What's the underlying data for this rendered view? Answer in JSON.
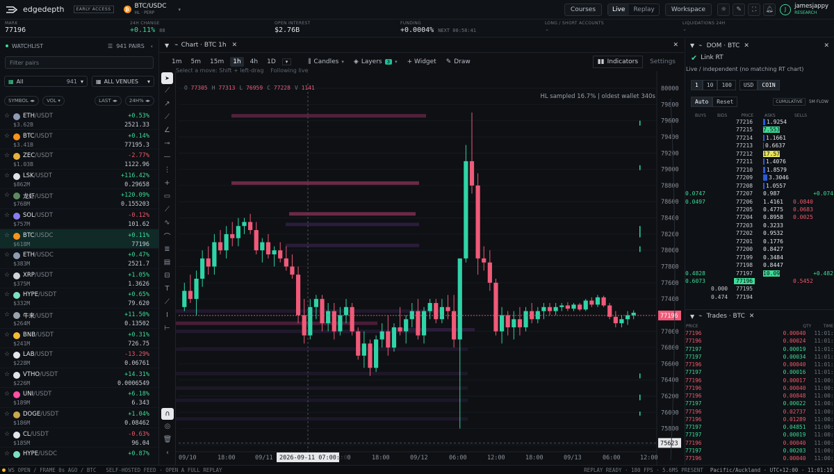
{
  "app": {
    "name": "edgedepth",
    "badge": "EARLY ACCESS",
    "symbol": "BTC/USDC",
    "symbol_sub": "HL · PERP"
  },
  "nav": {
    "courses": "Courses",
    "live": "Live",
    "replay": "Replay",
    "workspace": "Workspace",
    "user": "jamesjappy",
    "user_role": "RESEARCH",
    "avatar_initial": "J"
  },
  "stats": [
    {
      "label": "MARK",
      "value": "77196",
      "extra": ""
    },
    {
      "label": "24H CHANGE",
      "value": "+0.11%",
      "extra": "88"
    },
    {
      "label": "OPEN INTEREST",
      "value": "$2.76B",
      "extra": ""
    },
    {
      "label": "FUNDING",
      "value": "+0.0004%",
      "extra": "NEXT 00:58:41"
    },
    {
      "label": "LONG / SHORT ACCOUNTS",
      "value": "-",
      "extra": ""
    },
    {
      "label": "LIQUIDATIONS 24H",
      "value": "-",
      "extra": ""
    }
  ],
  "watchlist": {
    "title": "WATCHLIST",
    "pairs": "941 PAIRS",
    "filter_placeholder": "Filter pairs",
    "all_label": "All",
    "all_count": "941",
    "venues": "ALL VENUES",
    "sort": [
      "SYMBOL",
      "VOL",
      "LAST",
      "24H%"
    ],
    "rows": [
      {
        "base": "ETH",
        "quote": "/USDT",
        "vol": "$3.62B",
        "chg": "+0.53%",
        "price": "2521.33",
        "dir": "up",
        "icon": "#8e9bb5"
      },
      {
        "base": "BTC",
        "quote": "/USDT",
        "vol": "$3.41B",
        "chg": "+0.14%",
        "price": "77195.3",
        "dir": "up",
        "icon": "#f7931a"
      },
      {
        "base": "ZEC",
        "quote": "/USDT",
        "vol": "$1.03B",
        "chg": "-2.77%",
        "price": "1122.96",
        "dir": "down",
        "icon": "#e7b23c"
      },
      {
        "base": "LSK",
        "quote": "/USDT",
        "vol": "$862M",
        "chg": "+116.42%",
        "price": "0.29658",
        "dir": "up",
        "icon": "#dfe3ea"
      },
      {
        "base": "龙虾",
        "quote": "/USDT",
        "vol": "$768M",
        "chg": "+120.09%",
        "price": "0.155203",
        "dir": "up",
        "icon": "#5b8a5f"
      },
      {
        "base": "SOL",
        "quote": "/USDT",
        "vol": "$757M",
        "chg": "-0.12%",
        "price": "101.62",
        "dir": "down",
        "icon": "#8a7cf0"
      },
      {
        "base": "BTC",
        "quote": "/USDC",
        "vol": "$618M",
        "chg": "+0.11%",
        "price": "77196",
        "dir": "up",
        "icon": "#f7931a",
        "active": true
      },
      {
        "base": "ETH",
        "quote": "/USDC",
        "vol": "$383M",
        "chg": "+0.47%",
        "price": "2521.7",
        "dir": "up",
        "icon": "#8e9bb5"
      },
      {
        "base": "XRP",
        "quote": "/USDT",
        "vol": "$375M",
        "chg": "+1.05%",
        "price": "1.3626",
        "dir": "up",
        "icon": "#cfd4db"
      },
      {
        "base": "HYPE",
        "quote": "/USDT",
        "vol": "$332M",
        "chg": "+0.65%",
        "price": "79.620",
        "dir": "up",
        "icon": "#7be0c0"
      },
      {
        "base": "牛来",
        "quote": "/USDT",
        "vol": "$264M",
        "chg": "+11.50%",
        "price": "0.13502",
        "dir": "up",
        "icon": "#9aa2ad"
      },
      {
        "base": "BNB",
        "quote": "/USDT",
        "vol": "$241M",
        "chg": "+0.31%",
        "price": "726.75",
        "dir": "up",
        "icon": "#f3ba2f"
      },
      {
        "base": "LAB",
        "quote": "/USDT",
        "vol": "$228M",
        "chg": "-13.29%",
        "price": "0.06761",
        "dir": "down",
        "icon": "#e3e6ea"
      },
      {
        "base": "VTHO",
        "quote": "/USDT",
        "vol": "$226M",
        "chg": "+14.31%",
        "price": "0.0006549",
        "dir": "up",
        "icon": "#dfe3ea"
      },
      {
        "base": "UNI",
        "quote": "/USDT",
        "vol": "$189M",
        "chg": "+6.18%",
        "price": "6.343",
        "dir": "up",
        "icon": "#ff4fa3"
      },
      {
        "base": "DOGE",
        "quote": "/USDT",
        "vol": "$186M",
        "chg": "+1.04%",
        "price": "0.08462",
        "dir": "up",
        "icon": "#c9a74a"
      },
      {
        "base": "CL",
        "quote": "/USDT",
        "vol": "$185M",
        "chg": "-0.63%",
        "price": "96.04",
        "dir": "down",
        "icon": "#e3e6ea"
      },
      {
        "base": "HYPE",
        "quote": "/USDC",
        "vol": "",
        "chg": "+0.87%",
        "price": "",
        "dir": "up",
        "icon": "#7be0c0"
      }
    ]
  },
  "chart": {
    "tab": "Chart · BTC 1h",
    "timeframes": [
      "1m",
      "5m",
      "15m",
      "1h",
      "4h",
      "1D"
    ],
    "active_tf": "1h",
    "candles_label": "Candles",
    "layers_label": "Layers",
    "layers_count": "3",
    "widget_label": "+ Widget",
    "draw_label": "Draw",
    "indicators_label": "Indicators",
    "settings_label": "Settings",
    "hint": "Select a move: Shift + left-drag",
    "following": "Following live",
    "ohlcv": {
      "O": "77305",
      "H": "77313",
      "L": "76959",
      "C": "77228",
      "V": "1141"
    },
    "sampled": "HL sampled 16.7% | oldest wallet 340s",
    "current_price": "77196",
    "crosshair_price": "75623",
    "crosshair_time": "2026-09-11 07:00:00",
    "x_labels": [
      "09/10",
      "18:00",
      "09/11",
      "06:00",
      "12:00",
      "18:00",
      "09/12",
      "06:00",
      "12:00",
      "18:00",
      "09/13",
      "06:00",
      "12:00"
    ],
    "y_labels": [
      "80000",
      "79800",
      "79600",
      "79400",
      "79200",
      "79000",
      "78800",
      "78600",
      "78400",
      "78200",
      "78000",
      "77800",
      "77600",
      "77400",
      "77200",
      "77000",
      "76800",
      "76600",
      "76400",
      "76200",
      "76000",
      "75800",
      "75600"
    ]
  },
  "chart_data": {
    "type": "candlestick",
    "ylim": [
      75540,
      80060
    ],
    "candles": [
      [
        77300,
        77600,
        77250,
        77500
      ],
      [
        77500,
        77700,
        77350,
        77400
      ],
      [
        77400,
        77750,
        77200,
        77650
      ],
      [
        77650,
        78000,
        77550,
        77900
      ],
      [
        77900,
        78050,
        77700,
        77800
      ],
      [
        77800,
        78200,
        77700,
        78100
      ],
      [
        78100,
        78250,
        77950,
        78000
      ],
      [
        78000,
        78300,
        77900,
        78200
      ],
      [
        78200,
        78350,
        78050,
        78150
      ],
      [
        78150,
        78400,
        78050,
        78300
      ],
      [
        78300,
        78400,
        78200,
        78350
      ],
      [
        78350,
        78450,
        78200,
        78250
      ],
      [
        78250,
        78350,
        77950,
        78000
      ],
      [
        78000,
        78150,
        77850,
        78100
      ],
      [
        78100,
        78200,
        77900,
        77950
      ],
      [
        77950,
        78050,
        77800,
        78000
      ],
      [
        78000,
        78100,
        77850,
        77900
      ],
      [
        77900,
        78050,
        77750,
        77800
      ],
      [
        77800,
        77950,
        77650,
        77700
      ],
      [
        77700,
        77800,
        77100,
        77200
      ],
      [
        77200,
        77400,
        76850,
        76950
      ],
      [
        76950,
        77400,
        76900,
        77300
      ],
      [
        77300,
        77450,
        77150,
        77400
      ],
      [
        77400,
        77450,
        77000,
        77100
      ],
      [
        77100,
        77350,
        77000,
        77250
      ],
      [
        77250,
        77350,
        76900,
        77000
      ],
      [
        77000,
        77300,
        76950,
        77200
      ],
      [
        77200,
        77400,
        77100,
        77300
      ],
      [
        77300,
        77350,
        76950,
        77000
      ],
      [
        77000,
        77050,
        76650,
        76700
      ],
      [
        76700,
        77000,
        76550,
        76850
      ],
      [
        76850,
        76900,
        76450,
        76550
      ],
      [
        76550,
        76950,
        76500,
        76900
      ],
      [
        76900,
        77100,
        76800,
        77000
      ],
      [
        77000,
        77200,
        76700,
        76800
      ],
      [
        76800,
        77100,
        76750,
        77050
      ],
      [
        77050,
        77300,
        76950,
        77000
      ],
      [
        77000,
        77200,
        76850,
        77150
      ],
      [
        77150,
        77350,
        77050,
        77250
      ],
      [
        77250,
        77400,
        76900,
        76950
      ],
      [
        76950,
        77300,
        76850,
        77250
      ],
      [
        77250,
        77400,
        77150,
        77350
      ],
      [
        77350,
        77400,
        77100,
        77150
      ],
      [
        77150,
        77400,
        77100,
        77300
      ],
      [
        77300,
        77450,
        77150,
        77250
      ],
      [
        77250,
        77450,
        76800,
        76900
      ],
      [
        76900,
        77300,
        75800,
        77900
      ],
      [
        77900,
        79300,
        77850,
        79100
      ],
      [
        79100,
        79700,
        78700,
        78800
      ],
      [
        78800,
        78950,
        77700,
        77900
      ],
      [
        77900,
        78050,
        77750,
        77850
      ],
      [
        77850,
        78000,
        77500,
        77600
      ],
      [
        77600,
        77650,
        76950,
        77000
      ],
      [
        77000,
        77300,
        76850,
        77200
      ],
      [
        77200,
        77250,
        76950,
        77050
      ],
      [
        77050,
        77250,
        76900,
        77150
      ],
      [
        77150,
        77300,
        76950,
        77050
      ],
      [
        77050,
        77300,
        77000,
        77250
      ],
      [
        77250,
        77350,
        77100,
        77150
      ],
      [
        77150,
        77300,
        77100,
        77250
      ],
      [
        77250,
        77350,
        77150,
        77300
      ],
      [
        77300,
        77350,
        77200,
        77250
      ],
      [
        77250,
        77350,
        77200,
        77300
      ],
      [
        77300,
        77350,
        77250,
        77320
      ],
      [
        77320,
        77360,
        77250,
        77280
      ],
      [
        77280,
        77350,
        77250,
        77330
      ],
      [
        77330,
        77350,
        77250,
        77270
      ],
      [
        77270,
        77400,
        77250,
        77380
      ],
      [
        77380,
        77420,
        77300,
        77330
      ],
      [
        77330,
        77450,
        77300,
        77420
      ],
      [
        77420,
        77440,
        77300,
        77320
      ],
      [
        77320,
        77350,
        77150,
        77180
      ],
      [
        77180,
        77250,
        77050,
        77100
      ],
      [
        77100,
        77200,
        77050,
        77150
      ],
      [
        77150,
        77250,
        77080,
        77200
      ],
      [
        77200,
        77260,
        77150,
        77230
      ]
    ]
  },
  "dom": {
    "title": "DOM · BTC",
    "link": "Link RT",
    "note": "Live / independent (no matching RT chart)",
    "sizes": [
      "1",
      "10",
      "100"
    ],
    "units": [
      "USD",
      "COIN"
    ],
    "auto": "Auto",
    "reset": "Reset",
    "cumulative": "CUMULATIVE",
    "smflow": "5M FLOW",
    "cols": [
      "BUYS",
      "BIDS",
      "PRICE",
      "ASKS",
      "SELLS"
    ],
    "rows": [
      {
        "buys": "",
        "bids": "",
        "price": "77216",
        "asks": "1.9254",
        "sells": ""
      },
      {
        "buys": "",
        "bids": "",
        "price": "77215",
        "asks": "7.553",
        "sells": ""
      },
      {
        "buys": "",
        "bids": "",
        "price": "77214",
        "asks": "1.1661",
        "sells": ""
      },
      {
        "buys": "",
        "bids": "",
        "price": "77213",
        "asks": "0.6637",
        "sells": ""
      },
      {
        "buys": "",
        "bids": "",
        "price": "77212",
        "asks": "17.57",
        "sells": ""
      },
      {
        "buys": "",
        "bids": "",
        "price": "77211",
        "asks": "1.4076",
        "sells": ""
      },
      {
        "buys": "",
        "bids": "",
        "price": "77210",
        "asks": "1.8579",
        "sells": ""
      },
      {
        "buys": "",
        "bids": "",
        "price": "77209",
        "asks": "3.3046",
        "sells": ""
      },
      {
        "buys": "",
        "bids": "",
        "price": "77208",
        "asks": "1.0557",
        "sells": ""
      },
      {
        "buys": "0.0747",
        "bids": "",
        "price": "77207",
        "asks": "0.987",
        "sells": "+0.074"
      },
      {
        "buys": "0.0497",
        "bids": "",
        "price": "77206",
        "asks": "1.4161",
        "sells": "0.0840"
      },
      {
        "buys": "",
        "bids": "",
        "price": "77205",
        "asks": "0.4775",
        "sells": "0.0683"
      },
      {
        "buys": "",
        "bids": "",
        "price": "77204",
        "asks": "0.8958",
        "sells": "0.0025"
      },
      {
        "buys": "",
        "bids": "",
        "price": "77203",
        "asks": "0.3233",
        "sells": ""
      },
      {
        "buys": "",
        "bids": "",
        "price": "77202",
        "asks": "0.9532",
        "sells": ""
      },
      {
        "buys": "",
        "bids": "",
        "price": "77201",
        "asks": "0.1776",
        "sells": ""
      },
      {
        "buys": "",
        "bids": "",
        "price": "77200",
        "asks": "0.8427",
        "sells": ""
      },
      {
        "buys": "",
        "bids": "",
        "price": "77199",
        "asks": "0.3484",
        "sells": ""
      },
      {
        "buys": "",
        "bids": "",
        "price": "77198",
        "asks": "0.8447",
        "sells": ""
      },
      {
        "buys": "0.4828",
        "bids": "",
        "price": "77197",
        "asks": "10.09",
        "sells": "+0.482"
      },
      {
        "buys": "0.6073",
        "bids": "",
        "price": "77196",
        "asks": "",
        "sells": "0.5452"
      },
      {
        "buys": "",
        "bids": "0.000",
        "price": "77195",
        "asks": "",
        "sells": ""
      },
      {
        "buys": "",
        "bids": "0.474",
        "price": "77194",
        "asks": "",
        "sells": ""
      }
    ]
  },
  "trades": {
    "title": "Trades · BTC",
    "cols": [
      "PRICE",
      "QTY",
      "TIME"
    ],
    "rows": [
      {
        "price": "77196",
        "qty": "0.00040",
        "time": "11:01:19",
        "side": "sell"
      },
      {
        "price": "77196",
        "qty": "0.00024",
        "time": "11:01:14",
        "side": "sell"
      },
      {
        "price": "77197",
        "qty": "0.00019",
        "time": "11:01:10",
        "side": "buy"
      },
      {
        "price": "77197",
        "qty": "0.00034",
        "time": "11:01:08",
        "side": "buy"
      },
      {
        "price": "77196",
        "qty": "0.00040",
        "time": "11:01:03",
        "side": "sell"
      },
      {
        "price": "77197",
        "qty": "0.00016",
        "time": "11:01:00",
        "side": "buy"
      },
      {
        "price": "77196",
        "qty": "0.00017",
        "time": "11:00:59",
        "side": "sell"
      },
      {
        "price": "77196",
        "qty": "0.00040",
        "time": "11:00:56",
        "side": "sell"
      },
      {
        "price": "77196",
        "qty": "0.00848",
        "time": "11:00:52",
        "side": "sell"
      },
      {
        "price": "77197",
        "qty": "0.00022",
        "time": "11:00:49",
        "side": "buy"
      },
      {
        "price": "77196",
        "qty": "0.02737",
        "time": "11:00:48",
        "side": "sell"
      },
      {
        "price": "77196",
        "qty": "0.01289",
        "time": "11:00:47",
        "side": "sell"
      },
      {
        "price": "77197",
        "qty": "0.04851",
        "time": "11:00:46",
        "side": "buy"
      },
      {
        "price": "77197",
        "qty": "0.00019",
        "time": "11:00:44",
        "side": "buy"
      },
      {
        "price": "77196",
        "qty": "0.00040",
        "time": "11:00:43",
        "side": "sell"
      },
      {
        "price": "77197",
        "qty": "0.00203",
        "time": "11:00:42",
        "side": "buy"
      },
      {
        "price": "77196",
        "qty": "0.00040",
        "time": "11:00:40",
        "side": "sell"
      }
    ]
  },
  "status": {
    "left": "WS OPEN / FRAME 0s AGO / BTC",
    "feed": "SELF-HOSTED FEED · OPEN A FULL REPLAY",
    "right": "REPLAY READY · 180 FPS · 5.6MS PRESENT",
    "tz": "Pacific/Auckland · UTC+12:00 · 11:01:19"
  },
  "colors": {
    "up": "#3ddc97",
    "down": "#f0596a",
    "accent": "#1fbf9a",
    "bg": "#0e1014"
  }
}
